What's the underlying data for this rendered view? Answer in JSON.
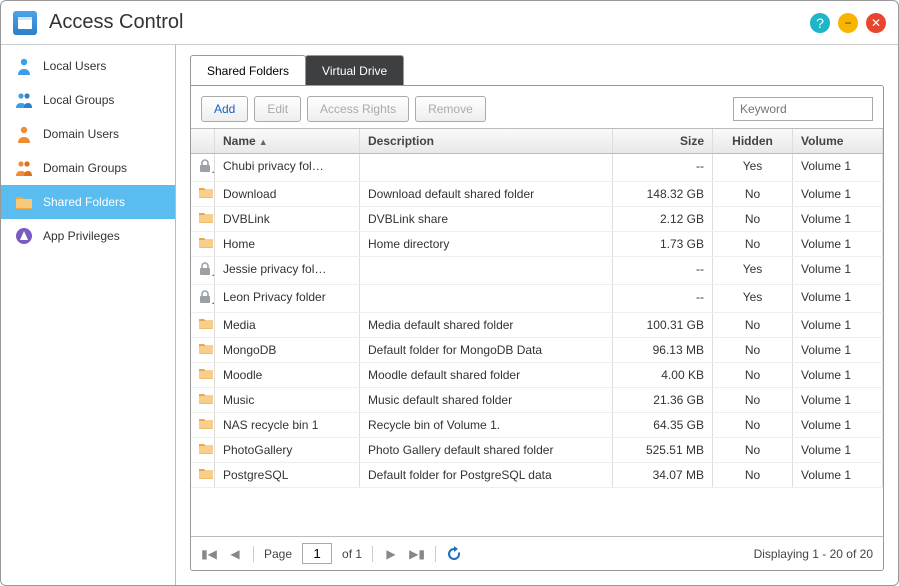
{
  "title": "Access Control",
  "sidebar": {
    "items": [
      {
        "label": "Local Users",
        "icon": "person-blue"
      },
      {
        "label": "Local Groups",
        "icon": "people-blue"
      },
      {
        "label": "Domain Users",
        "icon": "person-orange"
      },
      {
        "label": "Domain Groups",
        "icon": "people-orange"
      },
      {
        "label": "Shared Folders",
        "icon": "folder-orange",
        "active": true
      },
      {
        "label": "App Privileges",
        "icon": "app-purple"
      }
    ]
  },
  "tabs": [
    {
      "label": "Shared Folders",
      "active": true
    },
    {
      "label": "Virtual Drive",
      "active": false
    }
  ],
  "toolbar": {
    "add": "Add",
    "edit": "Edit",
    "rights": "Access Rights",
    "remove": "Remove",
    "search_placeholder": "Keyword"
  },
  "columns": {
    "name": "Name",
    "desc": "Description",
    "size": "Size",
    "hidden": "Hidden",
    "volume": "Volume"
  },
  "rows": [
    {
      "icon": "lock",
      "name": "Chubi privacy fol…",
      "desc": "",
      "size": "--",
      "hidden": "Yes",
      "volume": "Volume 1"
    },
    {
      "icon": "folder",
      "name": "Download",
      "desc": "Download default shared folder",
      "size": "148.32 GB",
      "hidden": "No",
      "volume": "Volume 1"
    },
    {
      "icon": "folder",
      "name": "DVBLink",
      "desc": "DVBLink share",
      "size": "2.12 GB",
      "hidden": "No",
      "volume": "Volume 1"
    },
    {
      "icon": "folder",
      "name": "Home",
      "desc": "Home directory",
      "size": "1.73 GB",
      "hidden": "No",
      "volume": "Volume 1"
    },
    {
      "icon": "lock",
      "name": "Jessie privacy fol…",
      "desc": "",
      "size": "--",
      "hidden": "Yes",
      "volume": "Volume 1"
    },
    {
      "icon": "lock",
      "name": "Leon Privacy folder",
      "desc": "",
      "size": "--",
      "hidden": "Yes",
      "volume": "Volume 1"
    },
    {
      "icon": "folder",
      "name": "Media",
      "desc": "Media default shared folder",
      "size": "100.31 GB",
      "hidden": "No",
      "volume": "Volume 1"
    },
    {
      "icon": "folder",
      "name": "MongoDB",
      "desc": "Default folder for MongoDB Data",
      "size": "96.13 MB",
      "hidden": "No",
      "volume": "Volume 1"
    },
    {
      "icon": "folder",
      "name": "Moodle",
      "desc": "Moodle default shared folder",
      "size": "4.00 KB",
      "hidden": "No",
      "volume": "Volume 1"
    },
    {
      "icon": "folder",
      "name": "Music",
      "desc": "Music default shared folder",
      "size": "21.36 GB",
      "hidden": "No",
      "volume": "Volume 1"
    },
    {
      "icon": "folder",
      "name": "NAS recycle bin 1",
      "desc": "Recycle bin of Volume 1.",
      "size": "64.35 GB",
      "hidden": "No",
      "volume": "Volume 1"
    },
    {
      "icon": "folder",
      "name": "PhotoGallery",
      "desc": "Photo Gallery default shared folder",
      "size": "525.51 MB",
      "hidden": "No",
      "volume": "Volume 1"
    },
    {
      "icon": "folder",
      "name": "PostgreSQL",
      "desc": "Default folder for PostgreSQL data",
      "size": "34.07 MB",
      "hidden": "No",
      "volume": "Volume 1"
    }
  ],
  "paging": {
    "page_label": "Page",
    "page_value": "1",
    "of_label": "of 1",
    "summary": "Displaying 1 - 20 of 20"
  }
}
